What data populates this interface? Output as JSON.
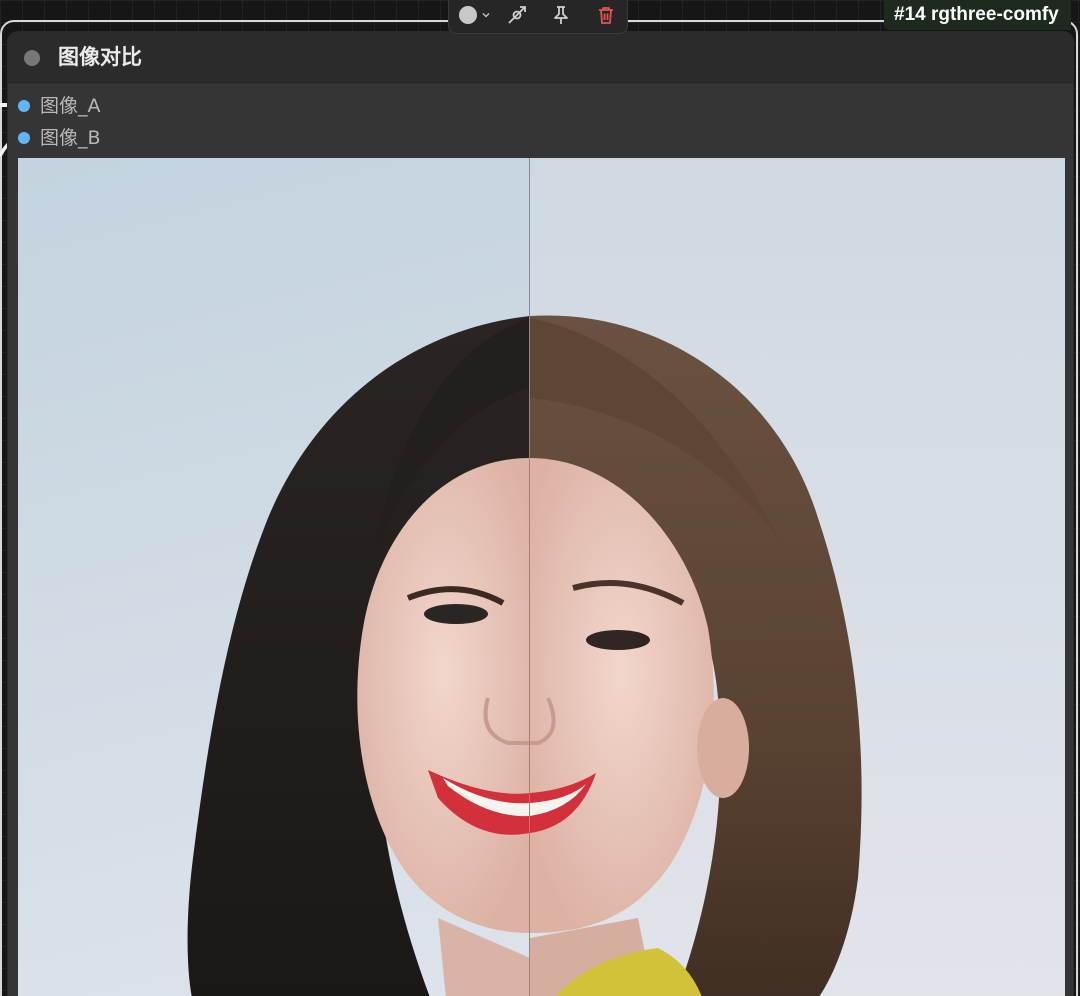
{
  "node": {
    "title": "图像对比",
    "badge": "#14 rgthree-comfy",
    "inputs": [
      {
        "label": "图像_A"
      },
      {
        "label": "图像_B"
      }
    ]
  },
  "toolbar": {
    "icons": [
      "color-circle-icon",
      "chevron-down-icon",
      "bypass-icon",
      "pin-icon",
      "trash-icon"
    ]
  },
  "preview": {
    "image_a": "portrait-dark-hair-icon",
    "image_b": "portrait-light-hair-icon"
  },
  "colors": {
    "slot_dot": "#64b5f6",
    "trash": "#e05555",
    "node_bg": "#353535",
    "header_bg": "#2b2b2b"
  }
}
